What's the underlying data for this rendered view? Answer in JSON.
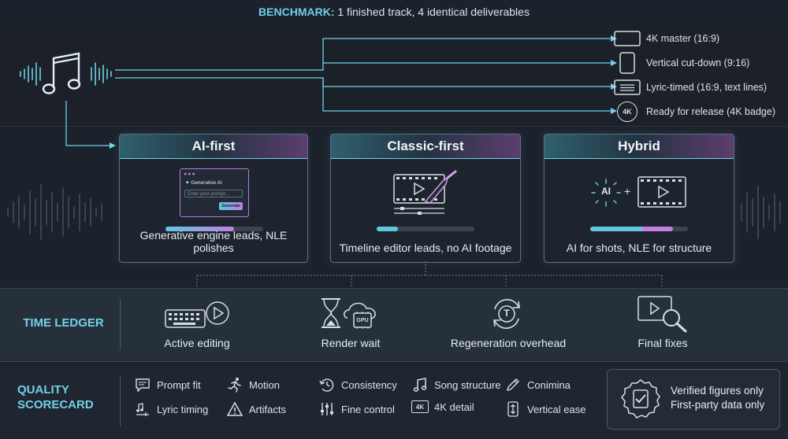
{
  "header": {
    "keyword": "BENCHMARK:",
    "text": " 1 finished track, 4 identical deliverables"
  },
  "deliverables": [
    {
      "label": "4K master (16:9)",
      "icon": "landscape-screen-icon"
    },
    {
      "label": "Vertical cut-down (9:16)",
      "icon": "portrait-phone-icon"
    },
    {
      "label": "Lyric-timed (16:9, text lines)",
      "icon": "text-lines-screen-icon"
    },
    {
      "label": "Ready for release (4K badge)",
      "icon": "4k-badge-icon",
      "badge": "4K"
    }
  ],
  "approaches": [
    {
      "title": "AI-first",
      "caption": "Generative engine leads, NLE polishes",
      "mock": {
        "title": "Generative AI",
        "placeholder": "Enter your prompt...",
        "button": "Generate"
      },
      "progress": 0.7
    },
    {
      "title": "Classic-first",
      "caption": "Timeline editor leads, no AI footage",
      "progress": 0.22
    },
    {
      "title": "Hybrid",
      "caption": "AI for shots, NLE for structure",
      "ai_label": "AI",
      "plus": "+",
      "progress": 0.85
    }
  ],
  "time_ledger": {
    "title": "TIME LEDGER",
    "items": [
      {
        "label": "Active editing",
        "icon": "keyboard-play-icon"
      },
      {
        "label": "Render wait",
        "icon": "hourglass-gpu-cloud-icon",
        "chip": "GPU"
      },
      {
        "label": "Regeneration overhead",
        "icon": "regenerate-cycle-icon",
        "glyph": "T"
      },
      {
        "label": "Final fixes",
        "icon": "video-magnifier-icon"
      }
    ]
  },
  "quality": {
    "title_line1": "QUALITY",
    "title_line2": "SCORECARD",
    "items": [
      {
        "label": "Prompt fit",
        "icon": "chat-bubble-icon"
      },
      {
        "label": "Motion",
        "icon": "running-figure-icon"
      },
      {
        "label": "Consistency",
        "icon": "clock-arrows-icon"
      },
      {
        "label": "Song structure",
        "icon": "music-note-icon"
      },
      {
        "label": "Conimina",
        "icon": "pen-icon"
      },
      {
        "label": "Lyric timing",
        "icon": "notes-timing-icon"
      },
      {
        "label": "Artifacts",
        "icon": "warning-triangle-icon"
      },
      {
        "label": "Fine control",
        "icon": "sliders-icon"
      },
      {
        "label": "4K detail",
        "icon": "4k-box-icon",
        "badge": "4K"
      },
      {
        "label": "Vertical ease",
        "icon": "vertical-arrows-icon"
      }
    ],
    "verified": {
      "line1": "Verified figures only",
      "line2": "First-party data only"
    }
  },
  "colors": {
    "cyan": "#6fd2e6",
    "magenta": "#d77de8",
    "background": "#1c222b"
  }
}
